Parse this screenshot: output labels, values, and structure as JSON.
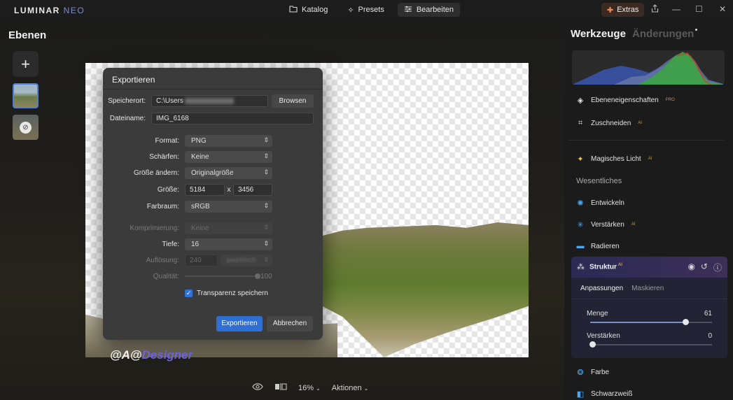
{
  "app": {
    "logo_main": "LUMINAR ",
    "logo_sub": "NEO"
  },
  "nav": {
    "katalog": "Katalog",
    "presets": "Presets",
    "bearbeiten": "Bearbeiten",
    "extras": "Extras"
  },
  "left_panel": {
    "title": "Ebenen",
    "add_symbol": "+"
  },
  "canvas_toolbar": {
    "zoom": "16%",
    "actions": "Aktionen"
  },
  "dialog": {
    "title": "Exportieren",
    "speicherort_label": "Speicherort:",
    "speicherort_value": "C:\\Users",
    "browse": "Browsen",
    "dateiname_label": "Dateiname:",
    "dateiname_value": "IMG_6168",
    "format_label": "Format:",
    "format_value": "PNG",
    "schaerfen_label": "Schärfen:",
    "schaerfen_value": "Keine",
    "groesse_aendern_label": "Größe ändern:",
    "groesse_aendern_value": "Originalgröße",
    "groesse_label": "Größe:",
    "width": "5184",
    "times": "x",
    "height": "3456",
    "farbraum_label": "Farbraum:",
    "farbraum_value": "sRGB",
    "komprimierung_label": "Komprimierung:",
    "komprimierung_value": "Keine",
    "tiefe_label": "Tiefe:",
    "tiefe_value": "16",
    "aufloesung_label": "Auflösung:",
    "aufloesung_value": "240",
    "aufloesung_unit": "pixel/inch",
    "qualitaet_label": "Qualität:",
    "qualitaet_value": "100",
    "transparenz": "Transparenz speichern",
    "export_btn": "Exportieren",
    "cancel_btn": "Abbrechen"
  },
  "watermark": {
    "part1": "@A@",
    "part2": "Designer"
  },
  "right_panel": {
    "tab_tools": "Werkzeuge",
    "tab_changes": "Änderungen",
    "tools": [
      {
        "label": "Ebeneneigenschaften",
        "badge": "PRO"
      },
      {
        "label": "Zuschneiden",
        "badge": "AI"
      },
      {
        "label": "Magisches Licht",
        "badge": "AI"
      }
    ],
    "section_essentials": "Wesentliches",
    "essentials": [
      {
        "label": "Entwickeln",
        "badge": ""
      },
      {
        "label": "Verstärken",
        "badge": "AI"
      },
      {
        "label": "Radieren",
        "badge": ""
      }
    ],
    "struktur": {
      "name": "Struktur",
      "badge": "AI",
      "tab_adjust": "Anpassungen",
      "tab_mask": "Maskieren",
      "menge_label": "Menge",
      "menge_value": "61",
      "menge_fraction": 0.78,
      "verstaerken_label": "Verstärken",
      "verstaerken_value": "0",
      "verstaerken_fraction": 0
    },
    "more_tools": [
      {
        "label": "Farbe"
      },
      {
        "label": "Schwarzweiß"
      }
    ]
  },
  "colors": {
    "accent": "#2f6fd3",
    "struktur_bg": "#2b2b54"
  }
}
